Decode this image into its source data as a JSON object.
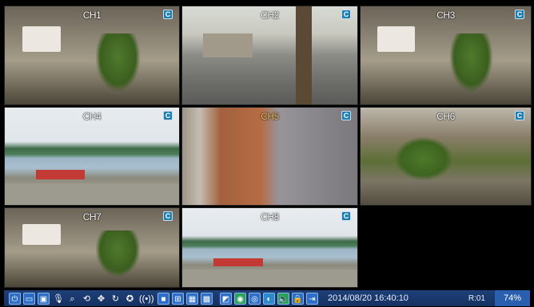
{
  "channels": [
    {
      "label": "CH1",
      "badge": "C",
      "scene": "garage"
    },
    {
      "label": "CH2",
      "badge": "C",
      "scene": "street"
    },
    {
      "label": "CH3",
      "badge": "C",
      "scene": "garage"
    },
    {
      "label": "CH4",
      "badge": "C",
      "scene": "coast"
    },
    {
      "label": "CH5",
      "badge": "C",
      "scene": "alley"
    },
    {
      "label": "CH6",
      "badge": "C",
      "scene": "yard"
    },
    {
      "label": "CH7",
      "badge": "C",
      "scene": "garage"
    },
    {
      "label": "CH8",
      "badge": "C",
      "scene": "coast"
    }
  ],
  "toolbar": {
    "icons": [
      "power-icon",
      "record-icon",
      "snapshot-icon",
      "microphone-icon",
      "zoom-icon",
      "playback-icon",
      "ptz-icon",
      "rotate-icon",
      "sequence-icon",
      "alarm-icon",
      "layout-1-icon",
      "layout-4-icon",
      "layout-9-icon",
      "layout-16-icon",
      "pip-icon",
      "network-icon",
      "hdd-icon",
      "volume-icon",
      "mute-icon",
      "lock-icon",
      "logout-icon"
    ],
    "datetime": "2014/08/20 16:40:10",
    "record_count": "R:01",
    "usage": "74%"
  }
}
